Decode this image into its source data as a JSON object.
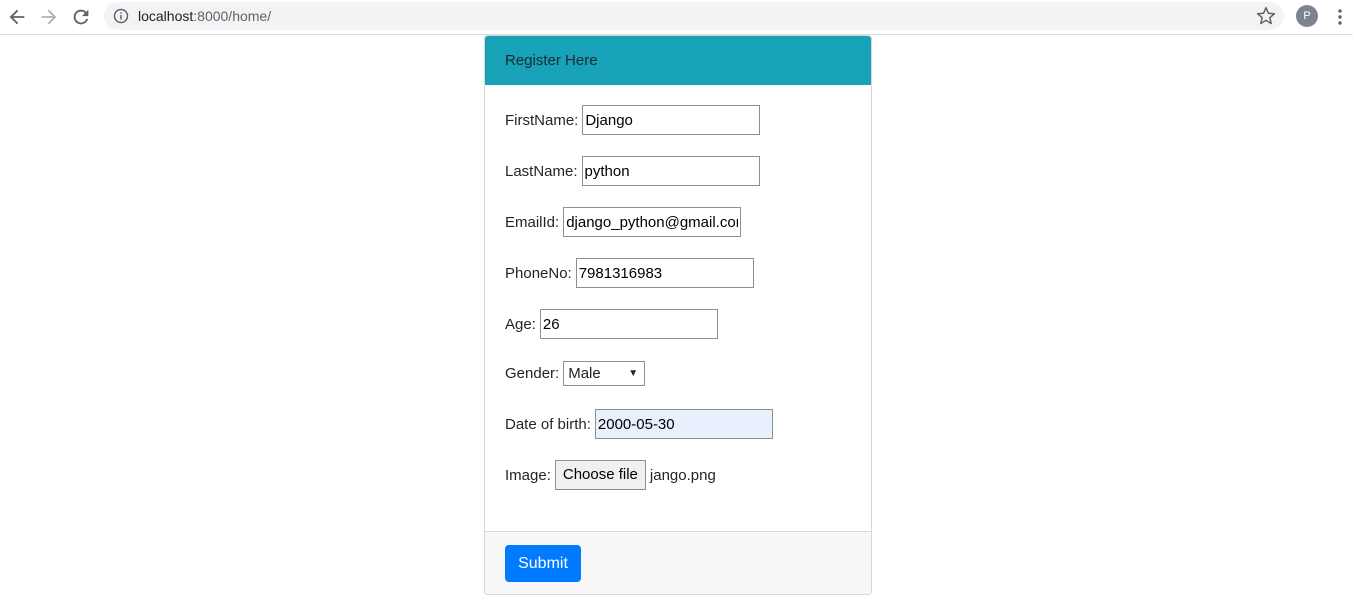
{
  "browser": {
    "url_host": "localhost",
    "url_path": ":8000/home/",
    "profile_initial": "P"
  },
  "form": {
    "header": "Register Here",
    "fields": {
      "firstname": {
        "label": "FirstName:",
        "value": "Django"
      },
      "lastname": {
        "label": "LastName:",
        "value": "python"
      },
      "email": {
        "label": "EmailId:",
        "value": "django_python@gmail.com"
      },
      "phone": {
        "label": "PhoneNo:",
        "value": "7981316983"
      },
      "age": {
        "label": "Age:",
        "value": "26"
      },
      "gender": {
        "label": "Gender:",
        "value": "Male"
      },
      "dob": {
        "label": "Date of birth:",
        "value": "2000-05-30"
      },
      "image": {
        "label": "Image:",
        "button": "Choose file",
        "filename": "jango.png"
      }
    },
    "submit_label": "Submit"
  },
  "colors": {
    "header_bg": "#17a2b8",
    "submit_bg": "#007bff",
    "dob_autofill_bg": "#e8f0fe"
  },
  "icons": [
    "back-arrow-icon",
    "forward-arrow-icon",
    "reload-icon",
    "info-icon",
    "star-icon",
    "menu-dots-icon"
  ]
}
